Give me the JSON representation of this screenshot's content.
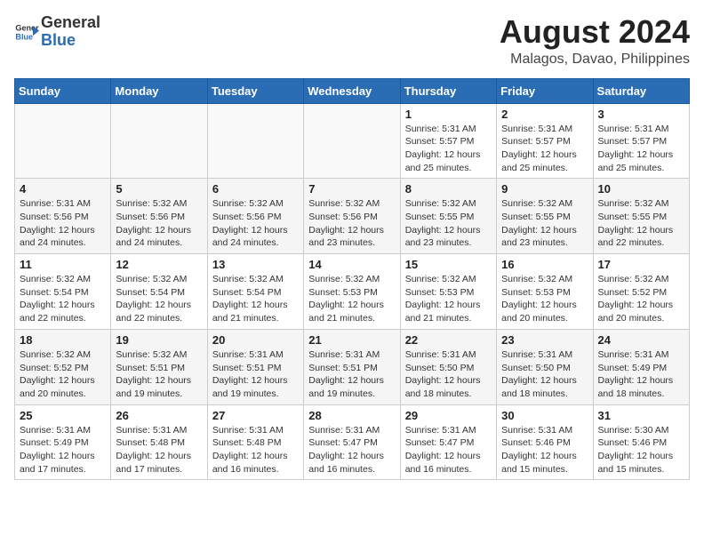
{
  "header": {
    "logo_line1": "General",
    "logo_line2": "Blue",
    "main_title": "August 2024",
    "subtitle": "Malagos, Davao, Philippines"
  },
  "weekdays": [
    "Sunday",
    "Monday",
    "Tuesday",
    "Wednesday",
    "Thursday",
    "Friday",
    "Saturday"
  ],
  "weeks": [
    [
      {
        "day": "",
        "info": ""
      },
      {
        "day": "",
        "info": ""
      },
      {
        "day": "",
        "info": ""
      },
      {
        "day": "",
        "info": ""
      },
      {
        "day": "1",
        "info": "Sunrise: 5:31 AM\nSunset: 5:57 PM\nDaylight: 12 hours\nand 25 minutes."
      },
      {
        "day": "2",
        "info": "Sunrise: 5:31 AM\nSunset: 5:57 PM\nDaylight: 12 hours\nand 25 minutes."
      },
      {
        "day": "3",
        "info": "Sunrise: 5:31 AM\nSunset: 5:57 PM\nDaylight: 12 hours\nand 25 minutes."
      }
    ],
    [
      {
        "day": "4",
        "info": "Sunrise: 5:31 AM\nSunset: 5:56 PM\nDaylight: 12 hours\nand 24 minutes."
      },
      {
        "day": "5",
        "info": "Sunrise: 5:32 AM\nSunset: 5:56 PM\nDaylight: 12 hours\nand 24 minutes."
      },
      {
        "day": "6",
        "info": "Sunrise: 5:32 AM\nSunset: 5:56 PM\nDaylight: 12 hours\nand 24 minutes."
      },
      {
        "day": "7",
        "info": "Sunrise: 5:32 AM\nSunset: 5:56 PM\nDaylight: 12 hours\nand 23 minutes."
      },
      {
        "day": "8",
        "info": "Sunrise: 5:32 AM\nSunset: 5:55 PM\nDaylight: 12 hours\nand 23 minutes."
      },
      {
        "day": "9",
        "info": "Sunrise: 5:32 AM\nSunset: 5:55 PM\nDaylight: 12 hours\nand 23 minutes."
      },
      {
        "day": "10",
        "info": "Sunrise: 5:32 AM\nSunset: 5:55 PM\nDaylight: 12 hours\nand 22 minutes."
      }
    ],
    [
      {
        "day": "11",
        "info": "Sunrise: 5:32 AM\nSunset: 5:54 PM\nDaylight: 12 hours\nand 22 minutes."
      },
      {
        "day": "12",
        "info": "Sunrise: 5:32 AM\nSunset: 5:54 PM\nDaylight: 12 hours\nand 22 minutes."
      },
      {
        "day": "13",
        "info": "Sunrise: 5:32 AM\nSunset: 5:54 PM\nDaylight: 12 hours\nand 21 minutes."
      },
      {
        "day": "14",
        "info": "Sunrise: 5:32 AM\nSunset: 5:53 PM\nDaylight: 12 hours\nand 21 minutes."
      },
      {
        "day": "15",
        "info": "Sunrise: 5:32 AM\nSunset: 5:53 PM\nDaylight: 12 hours\nand 21 minutes."
      },
      {
        "day": "16",
        "info": "Sunrise: 5:32 AM\nSunset: 5:53 PM\nDaylight: 12 hours\nand 20 minutes."
      },
      {
        "day": "17",
        "info": "Sunrise: 5:32 AM\nSunset: 5:52 PM\nDaylight: 12 hours\nand 20 minutes."
      }
    ],
    [
      {
        "day": "18",
        "info": "Sunrise: 5:32 AM\nSunset: 5:52 PM\nDaylight: 12 hours\nand 20 minutes."
      },
      {
        "day": "19",
        "info": "Sunrise: 5:32 AM\nSunset: 5:51 PM\nDaylight: 12 hours\nand 19 minutes."
      },
      {
        "day": "20",
        "info": "Sunrise: 5:31 AM\nSunset: 5:51 PM\nDaylight: 12 hours\nand 19 minutes."
      },
      {
        "day": "21",
        "info": "Sunrise: 5:31 AM\nSunset: 5:51 PM\nDaylight: 12 hours\nand 19 minutes."
      },
      {
        "day": "22",
        "info": "Sunrise: 5:31 AM\nSunset: 5:50 PM\nDaylight: 12 hours\nand 18 minutes."
      },
      {
        "day": "23",
        "info": "Sunrise: 5:31 AM\nSunset: 5:50 PM\nDaylight: 12 hours\nand 18 minutes."
      },
      {
        "day": "24",
        "info": "Sunrise: 5:31 AM\nSunset: 5:49 PM\nDaylight: 12 hours\nand 18 minutes."
      }
    ],
    [
      {
        "day": "25",
        "info": "Sunrise: 5:31 AM\nSunset: 5:49 PM\nDaylight: 12 hours\nand 17 minutes."
      },
      {
        "day": "26",
        "info": "Sunrise: 5:31 AM\nSunset: 5:48 PM\nDaylight: 12 hours\nand 17 minutes."
      },
      {
        "day": "27",
        "info": "Sunrise: 5:31 AM\nSunset: 5:48 PM\nDaylight: 12 hours\nand 16 minutes."
      },
      {
        "day": "28",
        "info": "Sunrise: 5:31 AM\nSunset: 5:47 PM\nDaylight: 12 hours\nand 16 minutes."
      },
      {
        "day": "29",
        "info": "Sunrise: 5:31 AM\nSunset: 5:47 PM\nDaylight: 12 hours\nand 16 minutes."
      },
      {
        "day": "30",
        "info": "Sunrise: 5:31 AM\nSunset: 5:46 PM\nDaylight: 12 hours\nand 15 minutes."
      },
      {
        "day": "31",
        "info": "Sunrise: 5:30 AM\nSunset: 5:46 PM\nDaylight: 12 hours\nand 15 minutes."
      }
    ]
  ]
}
